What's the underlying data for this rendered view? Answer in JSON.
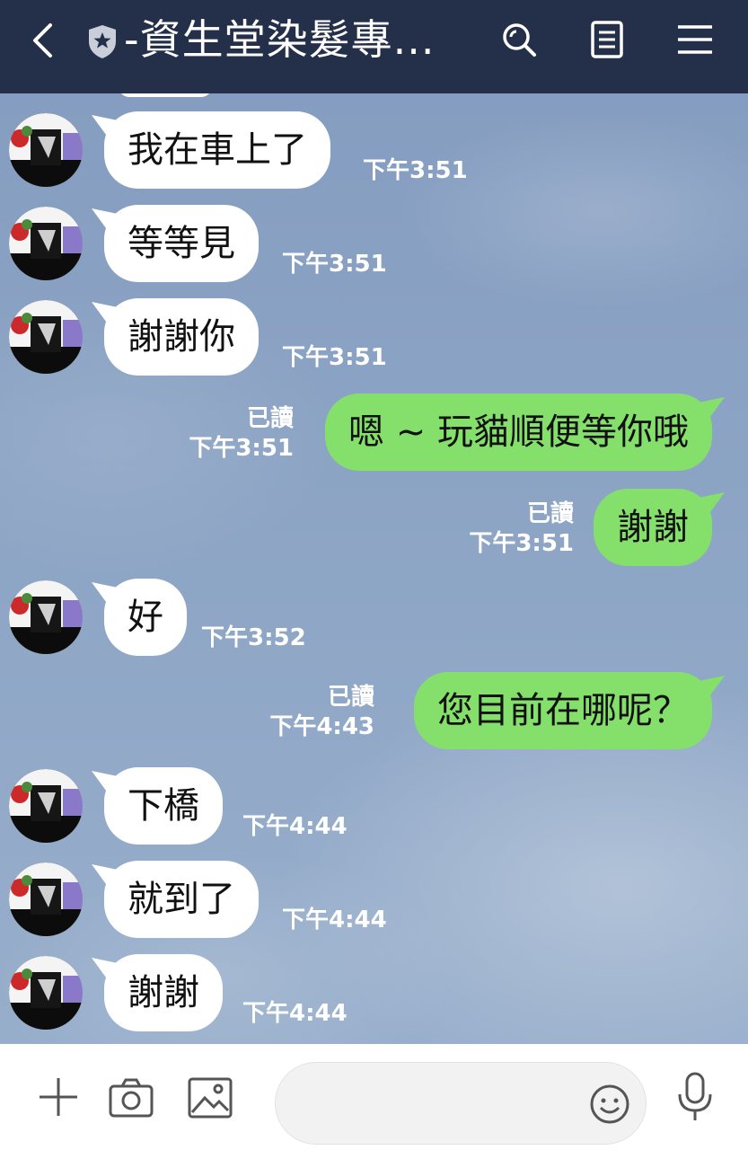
{
  "header": {
    "title": "-資生堂染髮專...",
    "icons": [
      "back-icon",
      "shield-icon",
      "search-icon",
      "notes-icon",
      "menu-icon"
    ]
  },
  "colors": {
    "header_bg": "#24304a",
    "bubble_incoming": "#ffffff",
    "bubble_outgoing": "#84e06a",
    "chat_bg": "#8da3c2"
  },
  "messages": [
    {
      "from": "them",
      "text": "我在車上了",
      "time": "下午3:51"
    },
    {
      "from": "them",
      "text": "等等見",
      "time": "下午3:51"
    },
    {
      "from": "them",
      "text": "謝謝你",
      "time": "下午3:51"
    },
    {
      "from": "me",
      "text": "嗯 ~ 玩貓順便等你哦",
      "read": "已讀",
      "time": "下午3:51"
    },
    {
      "from": "me",
      "text": "謝謝",
      "read": "已讀",
      "time": "下午3:51"
    },
    {
      "from": "them",
      "text": "好",
      "time": "下午3:52"
    },
    {
      "from": "me",
      "text": "您目前在哪呢？",
      "read": "已讀",
      "time": "下午4:43"
    },
    {
      "from": "them",
      "text": "下橋",
      "time": "下午4:44"
    },
    {
      "from": "them",
      "text": "就到了",
      "time": "下午4:44"
    },
    {
      "from": "them",
      "text": "謝謝",
      "time": "下午4:44"
    }
  ],
  "input": {
    "placeholder": "",
    "icons": [
      "plus-icon",
      "camera-icon",
      "image-icon",
      "emoji-icon",
      "microphone-icon"
    ]
  }
}
